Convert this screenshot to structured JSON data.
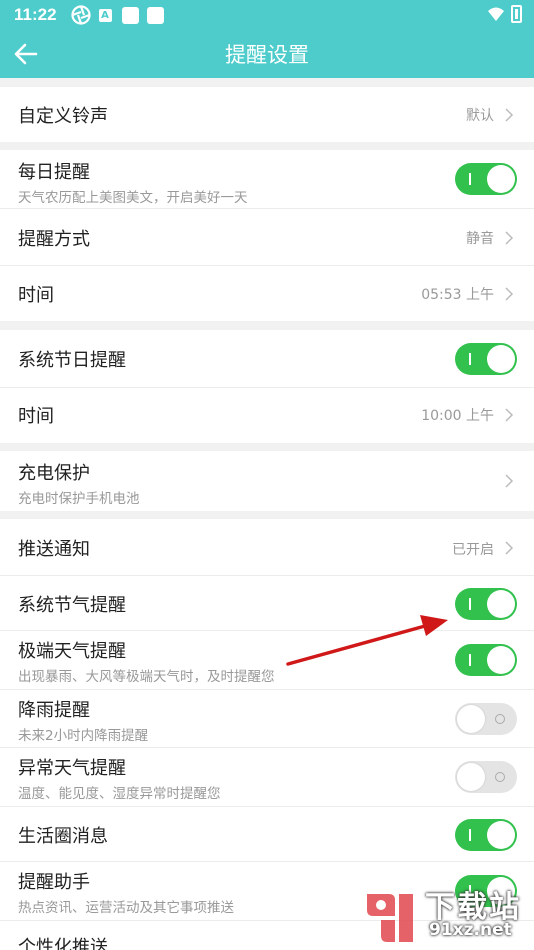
{
  "status_bar": {
    "time": "11:22",
    "a_icon_letter": "A"
  },
  "header": {
    "title": "提醒设置"
  },
  "groups": [
    {
      "rows": [
        {
          "label": "自定义铃声",
          "value": "默认"
        }
      ]
    },
    {
      "rows": [
        {
          "label": "每日提醒",
          "sub": "天气农历配上美图美文，开启美好一天",
          "toggle": true
        },
        {
          "label": "提醒方式",
          "value": "静音"
        },
        {
          "label": "时间",
          "value": "05:53 上午"
        }
      ]
    },
    {
      "rows": [
        {
          "label": "系统节日提醒",
          "toggle": true
        },
        {
          "label": "时间",
          "value": "10:00 上午"
        }
      ]
    },
    {
      "rows": [
        {
          "label": "充电保护",
          "sub": "充电时保护手机电池"
        }
      ]
    },
    {
      "rows": [
        {
          "label": "推送通知",
          "value": "已开启"
        },
        {
          "label": "系统节气提醒",
          "toggle": true
        },
        {
          "label": "极端天气提醒",
          "sub": "出现暴雨、大风等极端天气时，及时提醒您",
          "toggle": true
        },
        {
          "label": "降雨提醒",
          "sub": "未来2小时内降雨提醒",
          "toggle": false
        },
        {
          "label": "异常天气提醒",
          "sub": "温度、能见度、湿度异常时提醒您",
          "toggle": false
        },
        {
          "label": "生活圈消息",
          "toggle": true
        },
        {
          "label": "提醒助手",
          "sub": "热点资讯、运营活动及其它事项推送",
          "toggle": true
        },
        {
          "label": "个性化推送"
        }
      ]
    }
  ],
  "watermark": {
    "text": "下载站",
    "url": "91xz.net"
  },
  "colors": {
    "header": "#4ecccb",
    "toggle_on": "#31c14c",
    "arrow": "#d01818"
  }
}
